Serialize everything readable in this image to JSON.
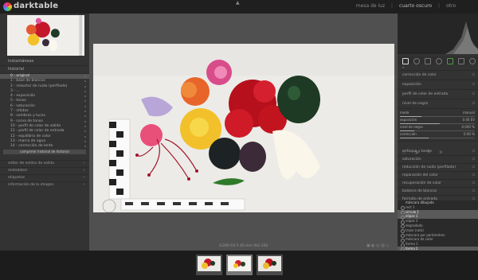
{
  "app": {
    "name": "darktable"
  },
  "views": {
    "lighttable": "mesa de luz",
    "darkroom": "cuarto oscuro",
    "more": "otro"
  },
  "left_panel": {
    "section_snapshots": "instantáneas",
    "section_history": "historial",
    "history_items": [
      "0 - original",
      "1 - base de blancos",
      "2 - reductor de ruido (perfilado)",
      "3 - ...",
      "4 - exposición",
      "5 - tonos",
      "6 - saturación",
      "7 - nitidez",
      "8 - sombras y luces",
      "9 - curva de tonos",
      "10 - perfil de color de salida",
      "11 - perfil de color de entrada",
      "12 - equilibrio de color",
      "13 - marca de agua",
      "14 - corrección de lente"
    ],
    "compress_label": "comprimir historial de historial",
    "collapsed_sections": [
      "editor de estilos de salida",
      "metadatos",
      "etiquetas",
      "información de la imagen"
    ]
  },
  "image_info": "1/200 f/4.5 45 mm ISO 100",
  "right_panel": {
    "module_groups": [
      "módulos activos",
      "básicos",
      "tonos",
      "color",
      "corrección",
      "efectos"
    ],
    "modules": [
      "corrección de color",
      "exposición",
      "perfil de color de entrada",
      "nivel de negro"
    ],
    "sliders": [
      {
        "label": "modo",
        "value": "manual"
      },
      {
        "label": "exposición",
        "value": "0.40 EV"
      },
      {
        "label": "nivel de negro",
        "value": "0.000 %"
      },
      {
        "label": "corrección",
        "value": "0.00 %"
      }
    ],
    "lower_modules": [
      "enfoque y borde",
      "saturación",
      "reducción de ruido (perfilado)",
      "reparación del color",
      "recuperación de color",
      "balance de blancos",
      "formato de entrada"
    ],
    "mask_header": "máscara dibujada",
    "mask_items": [
      "rect 1",
      "círculo 1",
      "elipse 1",
      "elipse 2",
      "degradado",
      "trazo (ruta)",
      "máscara por parámetros",
      "máscara de color",
      "forma 1",
      "forma 2"
    ]
  },
  "colors": {
    "accent": "#ffffff",
    "panel": "#333333",
    "center": "#505050",
    "topbar": "#1f1f1f"
  }
}
